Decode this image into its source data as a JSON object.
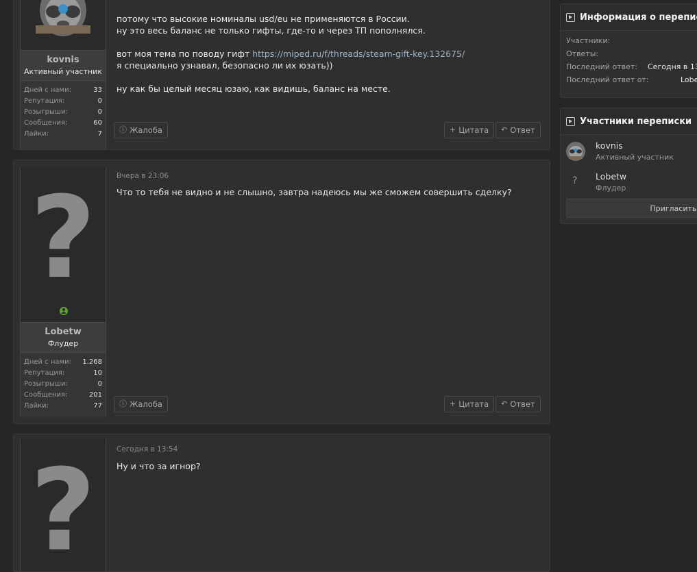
{
  "posts": [
    {
      "user": {
        "name": "kovnis",
        "title": "Активный участник"
      },
      "stats": [
        {
          "label": "Дней с нами:",
          "value": "33"
        },
        {
          "label": "Репутация:",
          "value": "0"
        },
        {
          "label": "Розыгрыши:",
          "value": "0"
        },
        {
          "label": "Сообщения:",
          "value": "60"
        },
        {
          "label": "Лайки:",
          "value": "7"
        }
      ],
      "body": {
        "line1": "потому что высокие номиналы usd/eu не применяются в России.",
        "line2": "ну это весь баланс не только гифты, где-то и через ТП пополнялся.",
        "line3_text": "вот моя тема по поводу гифт ",
        "line3_link": "https://miped.ru/f/threads/steam-gift-key.132675/",
        "line4": "я специально узнавал, безопасно ли их юзать))",
        "line5": "ну как бы целый месяц юзаю, как видишь, баланс на месте."
      }
    },
    {
      "date": "Вчера в 23:06",
      "user": {
        "name": "Lobetw",
        "title": "Флудер",
        "avatar_glyph": "?"
      },
      "stats": [
        {
          "label": "Дней с нами:",
          "value": "1.268"
        },
        {
          "label": "Репутация:",
          "value": "10"
        },
        {
          "label": "Розыгрыши:",
          "value": "0"
        },
        {
          "label": "Сообщения:",
          "value": "201"
        },
        {
          "label": "Лайки:",
          "value": "77"
        }
      ],
      "body": {
        "text": "Что то тебя не видно и не слышно, завтра надеюсь мы же сможем совершить сделку?"
      }
    },
    {
      "date": "Сегодня в 13:54",
      "user": {
        "avatar_glyph": "?"
      },
      "body": {
        "text": "Ну и что за игнор?"
      }
    }
  ],
  "actions": {
    "report": "Жалоба",
    "quote": "Цитата",
    "reply": "Ответ"
  },
  "sidebar": {
    "info": {
      "title": "Информация о переписке",
      "participants_label": "Участники:",
      "replies_label": "Ответы:",
      "last_reply_label": "Последний ответ:",
      "last_reply_value": "Сегодня в 13",
      "last_reply_by_label": "Последний ответ от:",
      "last_reply_by_value": "Lobe"
    },
    "members": {
      "title": "Участники переписки",
      "list": [
        {
          "name": "kovnis",
          "title": "Активный участник"
        },
        {
          "name": "Lobetw",
          "title": "Флудер",
          "avatar_glyph": "?"
        }
      ],
      "invite_label": "Пригласить ещ"
    }
  },
  "colors": {
    "online": "#5aa52a",
    "link": "#9fb3c8",
    "background": "#262626",
    "panel": "#2f2f2f"
  }
}
